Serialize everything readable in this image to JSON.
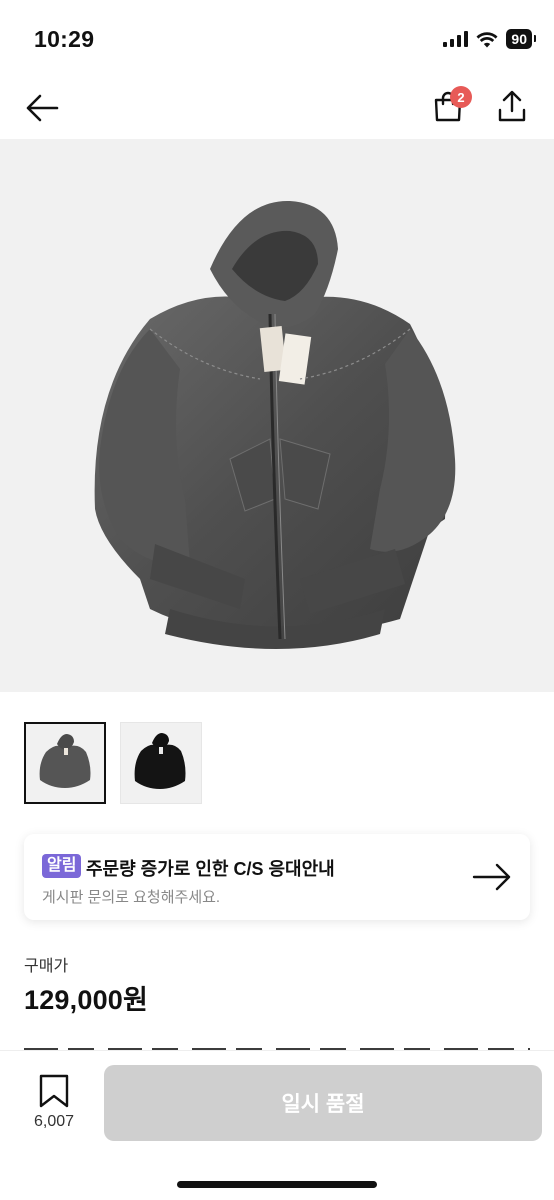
{
  "status_bar": {
    "time": "10:29",
    "battery": "90"
  },
  "header": {
    "back_icon": "arrow-left-icon",
    "bag_icon": "shopping-bag-icon",
    "bag_badge": "2",
    "share_icon": "share-icon"
  },
  "colors": {
    "badge": "#e75a57",
    "notice_tag": "#7b68d8",
    "soldout_button": "#cfcfcf",
    "image_bg": "#f1f1f1"
  },
  "thumbnails": [
    {
      "name": "charcoal-hoodie",
      "selected": true
    },
    {
      "name": "black-hoodie",
      "selected": false
    }
  ],
  "notice": {
    "tag": "알림",
    "title": "주문량 증가로 인한 C/S 응대안내",
    "subtitle": "게시판 문의로 요청해주세요.",
    "arrow_icon": "arrow-right-icon"
  },
  "price": {
    "label": "구매가",
    "value": "129,000원"
  },
  "bottom_bar": {
    "bookmark_icon": "bookmark-icon",
    "bookmark_count": "6,007",
    "soldout_label": "일시 품절"
  }
}
